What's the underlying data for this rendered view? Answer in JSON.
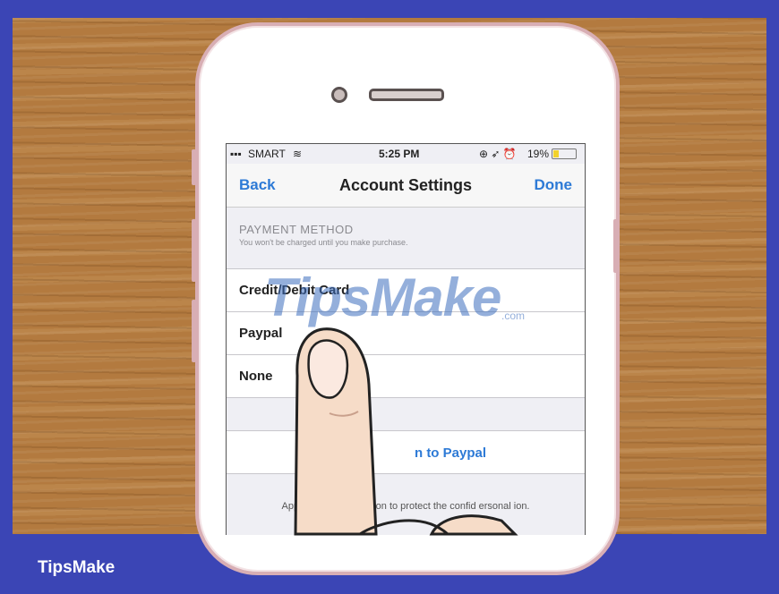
{
  "status_bar": {
    "carrier": "SMART",
    "time": "5:25 PM",
    "battery": "19%"
  },
  "nav": {
    "back_label": "Back",
    "title": "Account Settings",
    "done_label": "Done"
  },
  "payment": {
    "section_title": "PAYMENT METHOD",
    "section_subtitle": "You won't be charged until you make purchase.",
    "options": [
      "Credit/Debit Card",
      "Paypal",
      "None"
    ]
  },
  "signin_label": "n to Paypal",
  "footer_text": "Apple uses d encryption to protect the confid ersonal ion.",
  "watermark": {
    "brand": "TipsMake",
    "suffix": ".com"
  },
  "caption": "TipsMake",
  "colors": {
    "accent": "#2d7ad6",
    "frame": "#3b45b5",
    "wood": "#b37a3f"
  }
}
